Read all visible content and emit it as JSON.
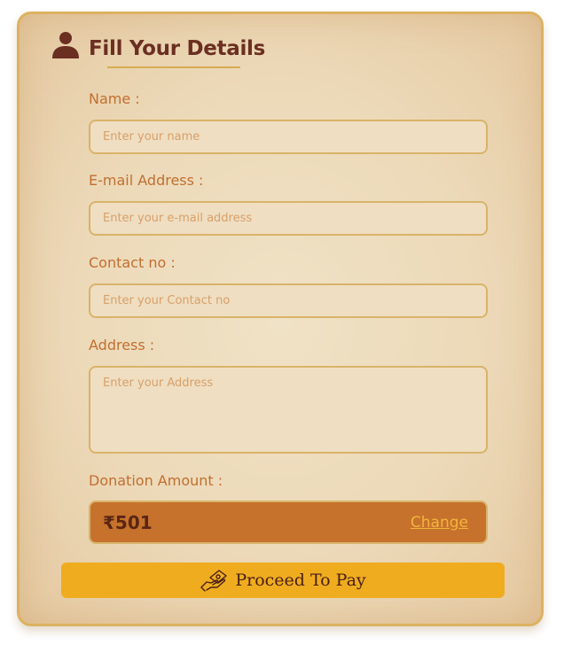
{
  "form": {
    "title": "Fill Your Details",
    "icon": "user-icon",
    "name": {
      "label": "Name :",
      "placeholder": "Enter your name"
    },
    "email": {
      "label": "E-mail Address :",
      "placeholder": "Enter your e-mail address"
    },
    "contact": {
      "label": "Contact no :",
      "placeholder": "Enter your Contact no"
    },
    "address": {
      "label": "Address :",
      "placeholder": "Enter your Address"
    },
    "donation": {
      "label": "Donation Amount :",
      "currency": "₹",
      "amount": "501",
      "change_label": "Change"
    },
    "submit": {
      "label": "Proceed To Pay",
      "icon": "hand-money-icon"
    }
  },
  "colors": {
    "title": "#6b2f22",
    "label": "#c16f30",
    "field_border": "#d9b36a",
    "amount_bg": "#c6722c",
    "button_bg": "#efac1f",
    "link": "#f3b53c"
  }
}
